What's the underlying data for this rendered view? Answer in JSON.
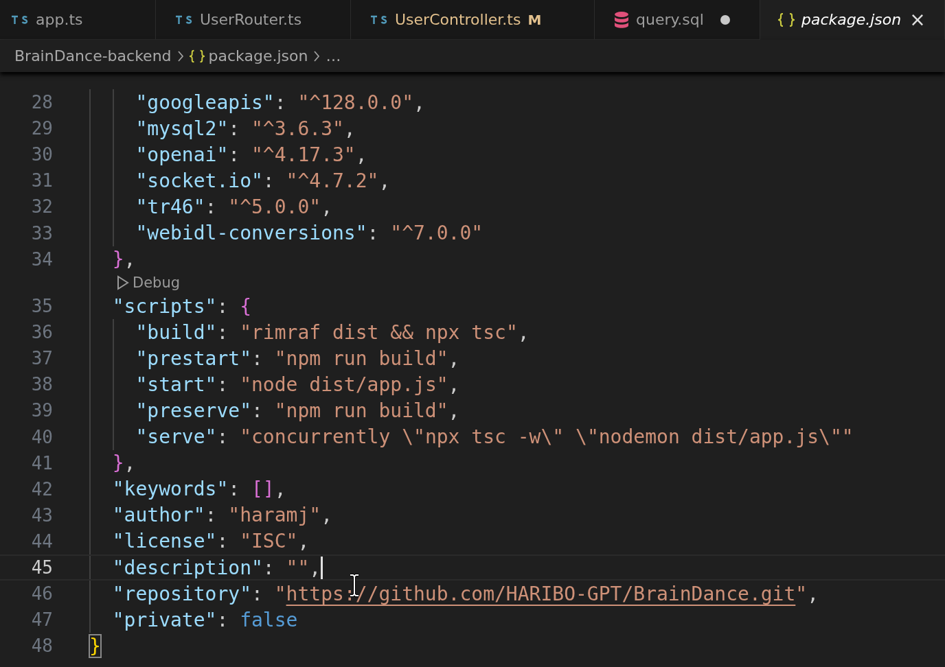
{
  "tabs": [
    {
      "kind": "ts",
      "label": "app.ts",
      "selected": false,
      "modified": false,
      "dirty": false,
      "preview": false
    },
    {
      "kind": "ts",
      "label": "UserRouter.ts",
      "selected": false,
      "modified": false,
      "dirty": false,
      "preview": false
    },
    {
      "kind": "ts",
      "label": "UserController.ts",
      "selected": false,
      "modified": true,
      "badge": "M",
      "dirty": false,
      "preview": false
    },
    {
      "kind": "sql",
      "label": "query.sql",
      "selected": false,
      "modified": false,
      "dirty": true,
      "preview": false
    },
    {
      "kind": "json",
      "label": "package.json",
      "selected": true,
      "modified": false,
      "dirty": false,
      "preview": true,
      "close": "×"
    }
  ],
  "breadcrumb": [
    {
      "kind": "folder",
      "label": "BrainDance-backend"
    },
    {
      "kind": "json",
      "label": "package.json"
    },
    {
      "kind": "more",
      "label": "…"
    }
  ],
  "editor": {
    "lines": [
      {
        "number": "28",
        "current": false,
        "tokens": [
          {
            "kind": "key",
            "text": "    \"googleapis\""
          },
          {
            "kind": "punct",
            "text": ": "
          },
          {
            "kind": "string",
            "text": "\"^128.0.0\""
          },
          {
            "kind": "punct",
            "text": ","
          }
        ]
      },
      {
        "number": "29",
        "current": false,
        "tokens": [
          {
            "kind": "key",
            "text": "    \"mysql2\""
          },
          {
            "kind": "punct",
            "text": ": "
          },
          {
            "kind": "string",
            "text": "\"^3.6.3\""
          },
          {
            "kind": "punct",
            "text": ","
          }
        ]
      },
      {
        "number": "30",
        "current": false,
        "tokens": [
          {
            "kind": "key",
            "text": "    \"openai\""
          },
          {
            "kind": "punct",
            "text": ": "
          },
          {
            "kind": "string",
            "text": "\"^4.17.3\""
          },
          {
            "kind": "punct",
            "text": ","
          }
        ]
      },
      {
        "number": "31",
        "current": false,
        "tokens": [
          {
            "kind": "key",
            "text": "    \"socket.io\""
          },
          {
            "kind": "punct",
            "text": ": "
          },
          {
            "kind": "string",
            "text": "\"^4.7.2\""
          },
          {
            "kind": "punct",
            "text": ","
          }
        ]
      },
      {
        "number": "32",
        "current": false,
        "tokens": [
          {
            "kind": "key",
            "text": "    \"tr46\""
          },
          {
            "kind": "punct",
            "text": ": "
          },
          {
            "kind": "string",
            "text": "\"^5.0.0\""
          },
          {
            "kind": "punct",
            "text": ","
          }
        ]
      },
      {
        "number": "33",
        "current": false,
        "tokens": [
          {
            "kind": "key",
            "text": "    \"webidl-conversions\""
          },
          {
            "kind": "punct",
            "text": ": "
          },
          {
            "kind": "string",
            "text": "\"^7.0.0\""
          }
        ]
      },
      {
        "number": "34",
        "current": false,
        "tokens": [
          {
            "kind": "bracket",
            "text": "  }",
            "color": "#da70d6",
            "matched": false
          },
          {
            "kind": "punct",
            "text": ","
          }
        ]
      },
      {
        "number": "35",
        "current": false,
        "codelens": "Debug",
        "tokens": [
          {
            "kind": "key",
            "text": "  \"scripts\""
          },
          {
            "kind": "punct",
            "text": ": "
          },
          {
            "kind": "bracket",
            "text": "{",
            "color": "#da70d6",
            "matched": false
          }
        ]
      },
      {
        "number": "36",
        "current": false,
        "tokens": [
          {
            "kind": "key",
            "text": "    \"build\""
          },
          {
            "kind": "punct",
            "text": ": "
          },
          {
            "kind": "string",
            "text": "\"rimraf dist && npx tsc\""
          },
          {
            "kind": "punct",
            "text": ","
          }
        ]
      },
      {
        "number": "37",
        "current": false,
        "tokens": [
          {
            "kind": "key",
            "text": "    \"prestart\""
          },
          {
            "kind": "punct",
            "text": ": "
          },
          {
            "kind": "string",
            "text": "\"npm run build\""
          },
          {
            "kind": "punct",
            "text": ","
          }
        ]
      },
      {
        "number": "38",
        "current": false,
        "tokens": [
          {
            "kind": "key",
            "text": "    \"start\""
          },
          {
            "kind": "punct",
            "text": ": "
          },
          {
            "kind": "string",
            "text": "\"node dist/app.js\""
          },
          {
            "kind": "punct",
            "text": ","
          }
        ]
      },
      {
        "number": "39",
        "current": false,
        "tokens": [
          {
            "kind": "key",
            "text": "    \"preserve\""
          },
          {
            "kind": "punct",
            "text": ": "
          },
          {
            "kind": "string",
            "text": "\"npm run build\""
          },
          {
            "kind": "punct",
            "text": ","
          }
        ]
      },
      {
        "number": "40",
        "current": false,
        "tokens": [
          {
            "kind": "key",
            "text": "    \"serve\""
          },
          {
            "kind": "punct",
            "text": ": "
          },
          {
            "kind": "string",
            "text": "\"concurrently \\\"npx tsc -w\\\" \\\"nodemon dist/app.js\\\"\""
          }
        ]
      },
      {
        "number": "41",
        "current": false,
        "tokens": [
          {
            "kind": "bracket",
            "text": "  }",
            "color": "#da70d6",
            "matched": false
          },
          {
            "kind": "punct",
            "text": ","
          }
        ]
      },
      {
        "number": "42",
        "current": false,
        "tokens": [
          {
            "kind": "key",
            "text": "  \"keywords\""
          },
          {
            "kind": "punct",
            "text": ": "
          },
          {
            "kind": "bracket",
            "text": "[]",
            "color": "#da70d6",
            "matched": false
          },
          {
            "kind": "punct",
            "text": ","
          }
        ]
      },
      {
        "number": "43",
        "current": false,
        "tokens": [
          {
            "kind": "key",
            "text": "  \"author\""
          },
          {
            "kind": "punct",
            "text": ": "
          },
          {
            "kind": "string",
            "text": "\"haramj\""
          },
          {
            "kind": "punct",
            "text": ","
          }
        ]
      },
      {
        "number": "44",
        "current": false,
        "tokens": [
          {
            "kind": "key",
            "text": "  \"license\""
          },
          {
            "kind": "punct",
            "text": ": "
          },
          {
            "kind": "string",
            "text": "\"ISC\""
          },
          {
            "kind": "punct",
            "text": ","
          }
        ]
      },
      {
        "number": "45",
        "current": true,
        "cursor": true,
        "tokens": [
          {
            "kind": "key",
            "text": "  \"description\""
          },
          {
            "kind": "punct",
            "text": ": "
          },
          {
            "kind": "string",
            "text": "\"\""
          },
          {
            "kind": "punct",
            "text": ","
          }
        ]
      },
      {
        "number": "46",
        "current": false,
        "tokens": [
          {
            "kind": "key",
            "text": "  \"repository\""
          },
          {
            "kind": "punct",
            "text": ": "
          },
          {
            "kind": "string",
            "text": "\""
          },
          {
            "kind": "link",
            "text": "https://github.com/HARIBO-GPT/BrainDance.git"
          },
          {
            "kind": "string",
            "text": "\""
          },
          {
            "kind": "punct",
            "text": ","
          }
        ]
      },
      {
        "number": "47",
        "current": false,
        "tokens": [
          {
            "kind": "key",
            "text": "  \"private\""
          },
          {
            "kind": "punct",
            "text": ": "
          },
          {
            "kind": "boolean",
            "text": "false"
          }
        ]
      },
      {
        "number": "48",
        "current": false,
        "tokens": [
          {
            "kind": "bracket",
            "text": "}",
            "color": "#ffd700",
            "matched": true
          }
        ]
      }
    ]
  }
}
